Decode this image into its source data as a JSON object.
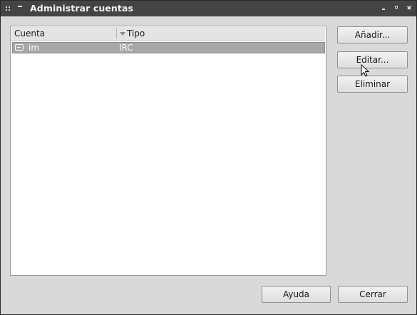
{
  "window": {
    "title": "Administrar cuentas"
  },
  "accounts_list": {
    "columns": [
      "Cuenta",
      "Tipo"
    ],
    "rows": [
      {
        "account": "im",
        "type": "IRC",
        "icon": "chat-bubble-icon"
      }
    ]
  },
  "side_buttons": {
    "add": "Añadir...",
    "edit": "Editar...",
    "delete": "Eliminar"
  },
  "footer_buttons": {
    "help": "Ayuda",
    "close": "Cerrar"
  },
  "colors": {
    "titlebar": "#444444",
    "window_bg": "#d9d9d9",
    "selected_row": "#a7a7a7"
  }
}
